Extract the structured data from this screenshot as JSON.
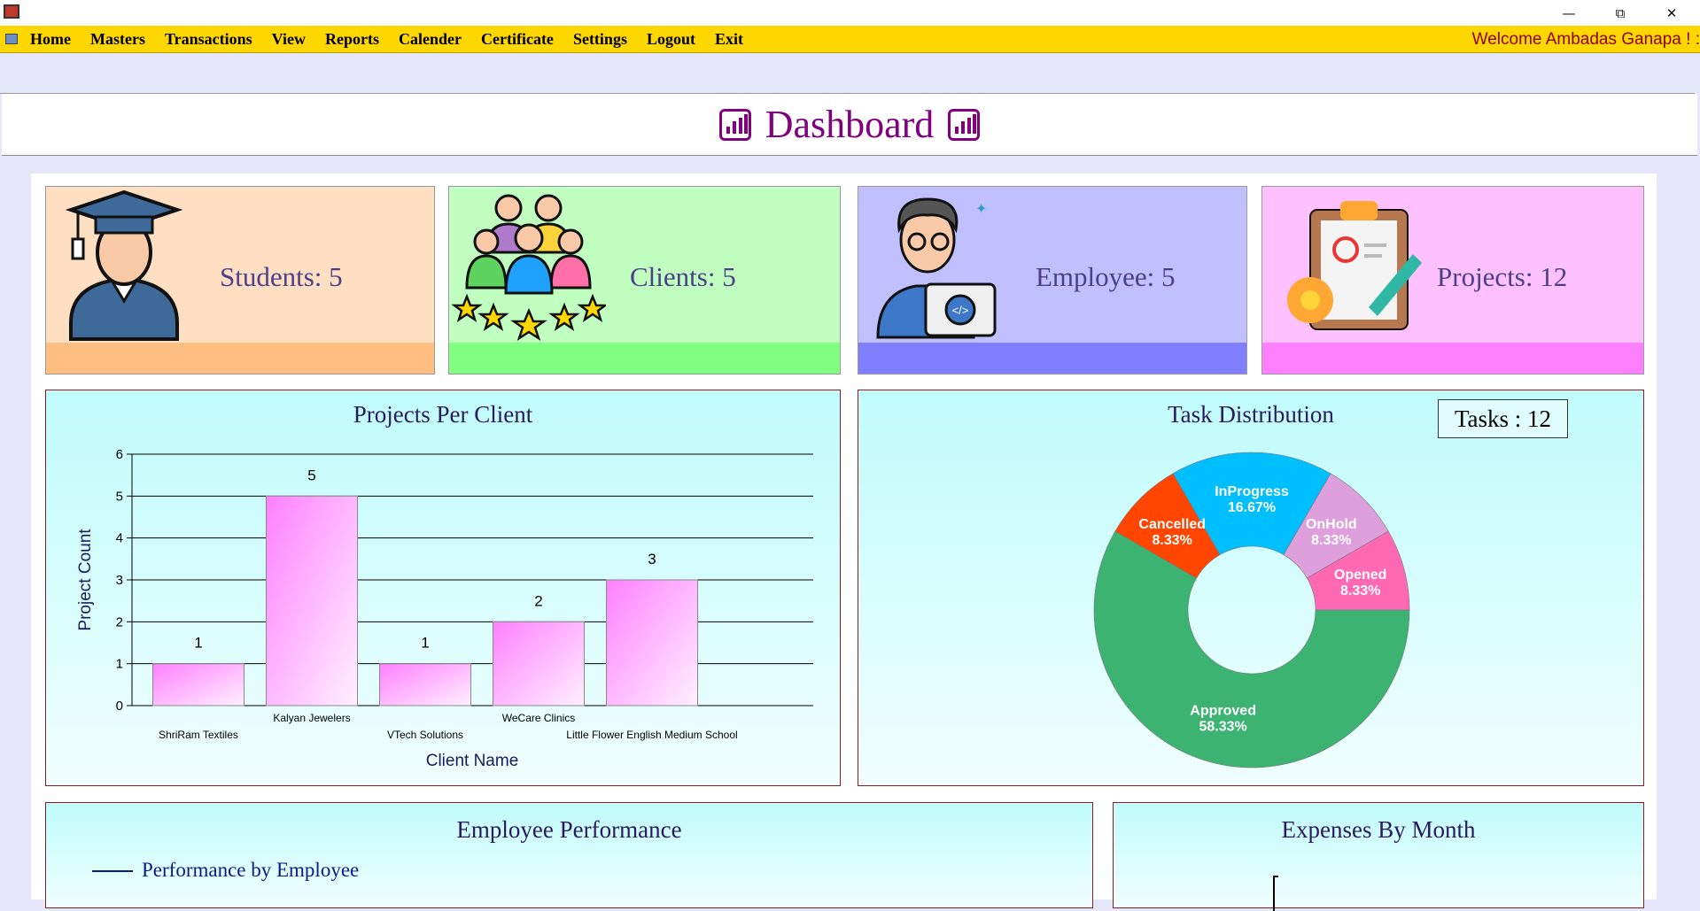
{
  "window": {
    "minimize_icon": "minimize-icon",
    "restore_icon": "restore-icon",
    "close_icon": "close-icon"
  },
  "menu": {
    "items": [
      "Home",
      "Masters",
      "Transactions",
      "View",
      "Reports",
      "Calender",
      "Certificate",
      "Settings",
      "Logout",
      "Exit"
    ],
    "welcome": "Welcome Ambadas Ganapa ! :"
  },
  "header": {
    "title": "Dashboard"
  },
  "cards": [
    {
      "label": "Students: 5",
      "bg": "#ffdfc2",
      "bar": "#ffbf80",
      "icon": "graduate-icon"
    },
    {
      "label": "Clients: 5",
      "bg": "#c0ffc0",
      "bar": "#80ff80",
      "icon": "clients-group-icon"
    },
    {
      "label": "Employee: 5",
      "bg": "#c0c0ff",
      "bar": "#8080ff",
      "icon": "developer-icon"
    },
    {
      "label": "Projects: 12",
      "bg": "#ffc0ff",
      "bar": "#ff80ff",
      "icon": "project-clipboard-icon"
    }
  ],
  "projects_panel": {
    "title": "Projects Per Client"
  },
  "tasks_panel": {
    "title": "Task Distribution",
    "tasks_count": "Tasks : 12"
  },
  "performance_panel": {
    "title": "Employee Performance",
    "legend": "Performance by Employee"
  },
  "expenses_panel": {
    "title": "Expenses By Month"
  },
  "chart_data": [
    {
      "type": "bar",
      "title": "Projects Per Client",
      "xlabel": "Client Name",
      "ylabel": "Project Count",
      "categories": [
        "ShriRam Textiles",
        "Kalyan Jewelers",
        "VTech Solutions",
        "WeCare Clinics",
        "Little Flower English Medium School"
      ],
      "values": [
        1,
        5,
        1,
        2,
        3
      ],
      "ylim": [
        0,
        6
      ],
      "yticks": [
        0,
        1,
        2,
        3,
        4,
        5,
        6
      ],
      "grid": true,
      "bar_color": "#ff80ff"
    },
    {
      "type": "pie",
      "title": "Task Distribution",
      "donut": true,
      "slices": [
        {
          "label": "InProgress",
          "pct": "16.67%",
          "value": 16.67,
          "color": "#00bfff"
        },
        {
          "label": "OnHold",
          "pct": "8.33%",
          "value": 8.33,
          "color": "#dda0dd"
        },
        {
          "label": "Opened",
          "pct": "8.33%",
          "value": 8.33,
          "color": "#ff69b4"
        },
        {
          "label": "Approved",
          "pct": "58.33%",
          "value": 58.33,
          "color": "#3cb371"
        },
        {
          "label": "Cancelled",
          "pct": "8.33%",
          "value": 8.33,
          "color": "#ff4500"
        }
      ]
    }
  ]
}
